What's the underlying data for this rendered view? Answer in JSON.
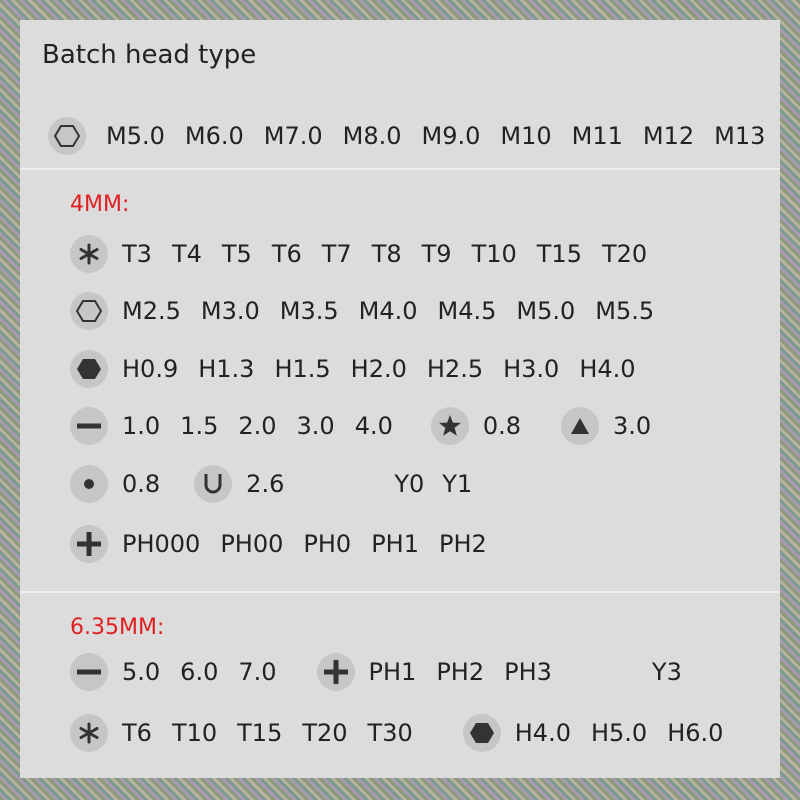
{
  "title": "Batch head type",
  "top_row": {
    "icon": "hexagon-outline-icon",
    "labels": [
      "M5.0",
      "M6.0",
      "M7.0",
      "M8.0",
      "M9.0",
      "M10",
      "M11",
      "M12",
      "M13"
    ]
  },
  "section_4mm": {
    "label": "4MM:",
    "torx": [
      "T3",
      "T4",
      "T5",
      "T6",
      "T7",
      "T8",
      "T9",
      "T10",
      "T15",
      "T20"
    ],
    "hex_outline": [
      "M2.5",
      "M3.0",
      "M3.5",
      "M4.0",
      "M4.5",
      "M5.0",
      "M5.5"
    ],
    "hex_solid": [
      "H0.9",
      "H1.3",
      "H1.5",
      "H2.0",
      "H2.5",
      "H3.0",
      "H4.0"
    ],
    "slotted": [
      "1.0",
      "1.5",
      "2.0",
      "3.0",
      "4.0"
    ],
    "star": "0.8",
    "triangle": "3.0",
    "dot": "0.8",
    "u_label": "2.6",
    "y": [
      "Y0",
      "Y1"
    ],
    "phillips": [
      "PH000",
      "PH00",
      "PH0",
      "PH1",
      "PH2"
    ]
  },
  "section_635mm": {
    "label": "6.35MM:",
    "slotted": [
      "5.0",
      "6.0",
      "7.0"
    ],
    "phillips": [
      "PH1",
      "PH2",
      "PH3"
    ],
    "y": "Y3",
    "torx": [
      "T6",
      "T10",
      "T15",
      "T20",
      "T30"
    ],
    "hex_solid": [
      "H4.0",
      "H5.0",
      "H6.0"
    ]
  }
}
